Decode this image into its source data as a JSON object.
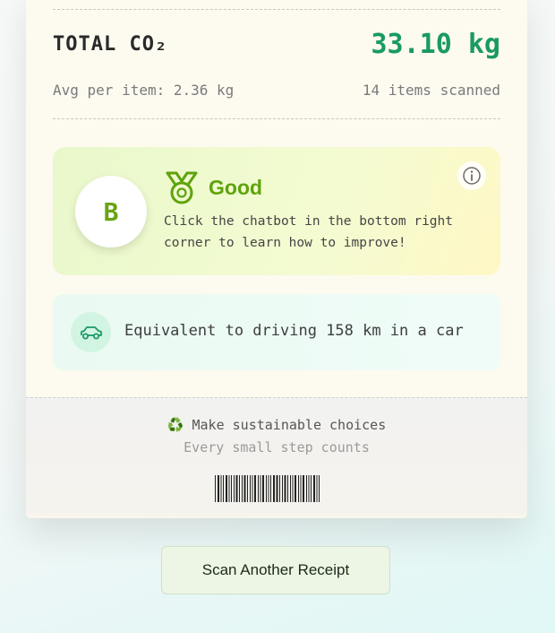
{
  "summary": {
    "total_label": "TOTAL CO₂",
    "total_value": "33.10 kg",
    "avg_text": "Avg per item: 2.36 kg",
    "items_text": "14 items scanned"
  },
  "grade": {
    "letter": "B",
    "title": "Good",
    "message": "Click the chatbot in the bottom right corner to learn how to improve!",
    "icon": "medal-icon",
    "info_icon": "info-icon",
    "accent_color": "#5fa30c"
  },
  "equivalent": {
    "icon": "car-icon",
    "text": "Equivalent to driving 158 km in a car"
  },
  "footer": {
    "recycle_icon": "♻️",
    "line1": "Make sustainable choices",
    "line2": "Every small step counts"
  },
  "actions": {
    "scan_again_label": "Scan Another Receipt"
  },
  "colors": {
    "total_green": "#1a9a63",
    "receipt_bg": "#fdfaf0"
  }
}
